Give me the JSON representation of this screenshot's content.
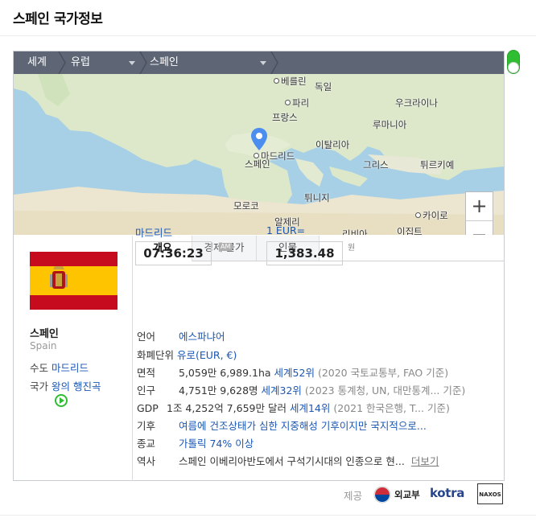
{
  "header": {
    "title": "스페인 국가정보"
  },
  "breadcrumb": {
    "level1": "세계",
    "level2": "유럽",
    "level3": "스페인"
  },
  "map": {
    "labels": {
      "berlin": "베를린",
      "germany": "독일",
      "paris": "파리",
      "ukraine": "우크라이나",
      "france": "프랑스",
      "romania": "루마니아",
      "italy": "이탈리아",
      "madrid": "마드리드",
      "spain": "스페인",
      "greece": "그리스",
      "turkey": "튀르키예",
      "tunisia": "튀니지",
      "morocco": "모로코",
      "algeria": "알제리",
      "cairo": "카이로",
      "libya": "리비아",
      "egypt": "이집트"
    },
    "zoom_in": "+",
    "zoom_out": "−",
    "marker_icon": "map-pin-icon"
  },
  "country": {
    "name": "스페인",
    "name_en": "Spain",
    "capital_label": "수도",
    "capital": "마드리드",
    "anthem_label": "국가",
    "anthem": "왕의 행진곡",
    "flag_colors": {
      "red": "#c60b1e",
      "yellow": "#ffc400"
    }
  },
  "tabs": [
    {
      "label": "개요",
      "active": true
    },
    {
      "label": "경제·물가",
      "active": false
    },
    {
      "label": "인물",
      "active": false
    }
  ],
  "clock": {
    "city": "마드리드",
    "time": "07:36:23",
    "ampm": "AM"
  },
  "exchange": {
    "label": "1 EUR=",
    "value": "1,383.48",
    "unit": "원"
  },
  "facts": {
    "language": {
      "label": "언어",
      "value": "에스파냐어"
    },
    "currency": {
      "label": "화폐단위",
      "value": "유로(EUR, €)"
    },
    "area": {
      "label": "면적",
      "value": "5,059만 6,989.1ha",
      "rank": "세계52위",
      "source": "(2020 국토교통부, FAO 기준)"
    },
    "population": {
      "label": "인구",
      "value": "4,751만 9,628명",
      "rank": "세계32위",
      "source": "(2023 통계청, UN, 대만통계... 기준)"
    },
    "gdp": {
      "label": "GDP",
      "value": "1조 4,252억 7,659만 달러",
      "rank": "세계14위",
      "source": "(2021 한국은행, T... 기준)"
    },
    "climate": {
      "label": "기후",
      "value": "여름에 건조상태가 심한 지중해성 기후이지만 국지적으로..."
    },
    "religion": {
      "label": "종교",
      "value": "가톨릭 74% 이상"
    },
    "history": {
      "label": "역사",
      "value": "스페인 이베리아반도에서 구석기시대의 인종으로 현...",
      "more": "더보기"
    }
  },
  "footer": {
    "provider_label": "제공",
    "mofa": "외교부",
    "kotra": "kotra",
    "naxos": "NAXOS"
  },
  "colors": {
    "accent": "#1a56b4",
    "toggle": "#2fbd32",
    "crumb_bg": "#5e6574"
  }
}
